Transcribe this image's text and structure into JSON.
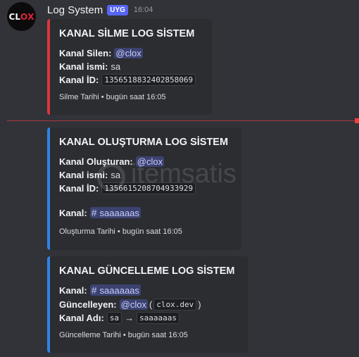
{
  "author": {
    "name": "Log System",
    "tag": "UYG",
    "time": "16:04",
    "avatar_text": "clox"
  },
  "embeds": [
    {
      "title": "KANAL SİLME LOG SİSTEM",
      "color": "#da373c",
      "silen_label": "Kanal Silen:",
      "silen_value": "@clox",
      "isim_label": "Kanal ismi:",
      "isim_value": "sa",
      "id_label": "Kanal İD:",
      "id_value": "1356518832402858069",
      "footer": "Silme Tarihi • bugün saat 16:05"
    },
    {
      "title": "KANAL OLUŞTURMA LOG SİSTEM",
      "color": "#2f84e6",
      "olusturan_label": "Kanal Oluşturan:",
      "olusturan_value": "@clox",
      "isim_label": "Kanal ismi:",
      "isim_value": "sa",
      "id_label": "Kanal İD:",
      "id_value": "1356615208704933929",
      "kanal_label": "Kanal:",
      "kanal_value": "saaaaaas",
      "footer": "Oluşturma Tarihi • bugün saat 16:05"
    },
    {
      "title": "KANAL GÜNCELLEME LOG SİSTEM",
      "color": "#2f84e6",
      "kanal_label": "Kanal:",
      "kanal_value": "saaaaaas",
      "guncelleyen_label": "Güncelleyen:",
      "guncelleyen_value": "@clox",
      "guncelleyen_code": "clox.dev",
      "adi_label": "Kanal Adı:",
      "adi_old": "sa",
      "adi_new": "saaaaaas",
      "footer": "Güncelleme Tarihi • bugün saat 16:05"
    }
  ],
  "watermark": {
    "text": "itemsatis"
  }
}
